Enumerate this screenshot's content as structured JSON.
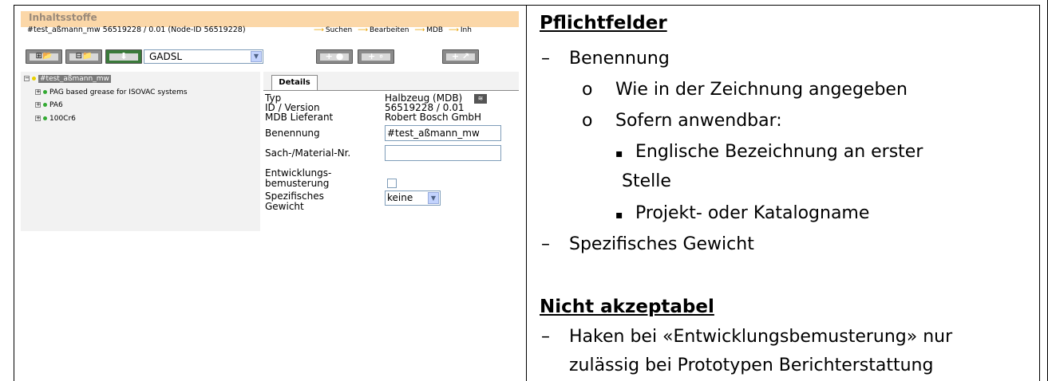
{
  "screenshot": {
    "header_title": "Inhaltsstoffe",
    "node_line": "#test_aßmann_mw 56519228 / 0.01 (Node-ID 56519228)",
    "links": [
      "Suchen",
      "Bearbeiten",
      "MDB",
      "Inh"
    ],
    "filter_select": "GADSL",
    "tree": {
      "root": "#test_aßmann_mw",
      "children": [
        "PAG based grease for ISOVAC systems",
        "PA6",
        "100Cr6"
      ]
    },
    "details": {
      "tab": "Details",
      "typ_label": "Typ",
      "typ_value": "Halbzeug (MDB)",
      "id_label": "ID / Version",
      "id_value": "56519228 / 0.01",
      "lieferant_label": "MDB Lieferant",
      "lieferant_value": "Robert Bosch GmbH",
      "benennung_label": "Benennung",
      "benennung_value": "#test_aßmann_mw",
      "sachnr_label": "Sach-/Material-Nr.",
      "sachnr_value": "",
      "entw_label_1": "Entwicklungs-",
      "entw_label_2": "bemusterung",
      "gewicht_label_1": "Spezifisches",
      "gewicht_label_2": "Gewicht",
      "gewicht_value": "keine"
    }
  },
  "notes": {
    "pflicht_heading": "Pflichtfelder",
    "dash": "–",
    "benennung": "Benennung",
    "bullet_o": "o",
    "wie_zeichnung": "Wie in der Zeichnung angegeben",
    "sofern": "Sofern anwendbar:",
    "square": "▪",
    "englische_1": "Englische Bezeichnung an erster",
    "englische_2": "Stelle",
    "projekt": "Projekt- oder Katalogname",
    "spez_gewicht": "Spezifisches Gewicht",
    "nicht_heading": "Nicht akzeptabel",
    "haken_1": "Haken bei «Entwicklungsbemusterung» nur",
    "haken_2": "zulässig bei Prototypen Berichterstattung"
  }
}
